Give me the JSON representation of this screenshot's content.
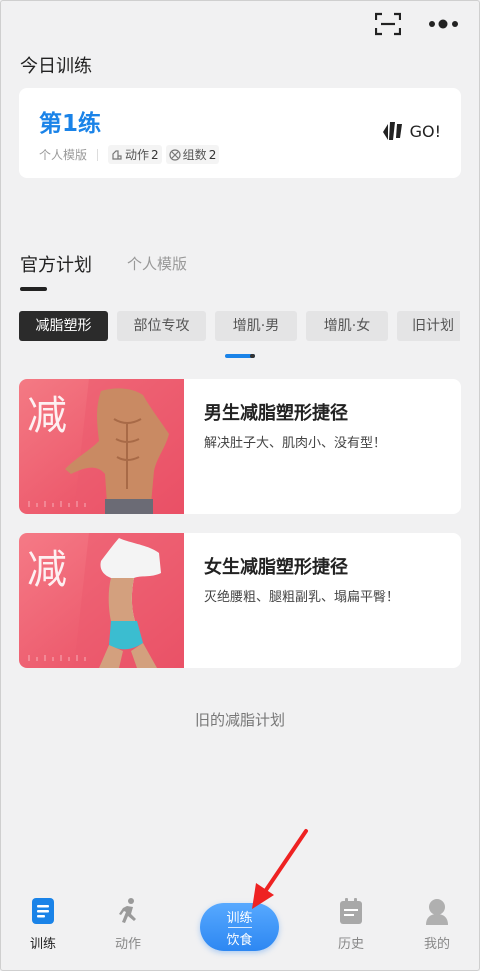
{
  "today": {
    "section_title": "今日训练",
    "day_title": "第1练",
    "template": "个人模版",
    "actions_label": "动作",
    "actions_count": "2",
    "groups_label": "组数",
    "groups_count": "2",
    "go_label": "GO!"
  },
  "tabs": {
    "official": "官方计划",
    "personal": "个人模版"
  },
  "chips": [
    "减脂塑形",
    "部位专攻",
    "增肌·男",
    "增肌·女",
    "旧计划"
  ],
  "plans": [
    {
      "badge": "减",
      "title": "男生减脂塑形捷径",
      "desc": "解决肚子大、肌肉小、没有型！"
    },
    {
      "badge": "减",
      "title": "女生减脂塑形捷径",
      "desc": "灭绝腰粗、腿粗副乳、塌扁平臀！"
    }
  ],
  "old_plans": "旧的减脂计划",
  "nav": {
    "train": "训练",
    "actions": "动作",
    "center_top": "训练",
    "center_bottom": "饮食",
    "history": "历史",
    "mine": "我的"
  },
  "colors": {
    "accent": "#1a83e8",
    "card_pink": "#f0586f",
    "arrow": "#ee2222"
  }
}
